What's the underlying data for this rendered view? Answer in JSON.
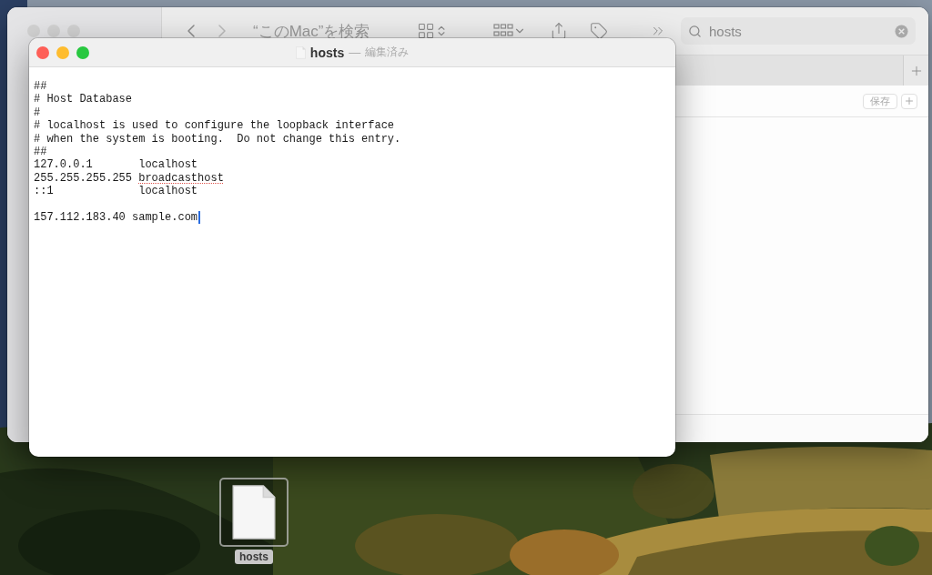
{
  "finder": {
    "title": "“このMac”を検索",
    "search": {
      "value": "hosts"
    },
    "save_button": "保存"
  },
  "editor": {
    "title": "hosts",
    "separator": "—",
    "status": "編集済み",
    "blocks": [
      {
        "lines": [
          {
            "segments": [
              {
                "text": "##",
                "misspelled": false
              }
            ],
            "caret": false
          },
          {
            "segments": [
              {
                "text": "# Host Database",
                "misspelled": false
              }
            ],
            "caret": false
          },
          {
            "segments": [
              {
                "text": "#",
                "misspelled": false
              }
            ],
            "caret": false
          },
          {
            "segments": [
              {
                "text": "# localhost is used to configure the loopback interface",
                "misspelled": false
              }
            ],
            "caret": false
          },
          {
            "segments": [
              {
                "text": "# when the system is booting.  Do not change this entry.",
                "misspelled": false
              }
            ],
            "caret": false
          },
          {
            "segments": [
              {
                "text": "##",
                "misspelled": false
              }
            ],
            "caret": false
          },
          {
            "segments": [
              {
                "text": "127.0.0.1       localhost",
                "misspelled": false
              }
            ],
            "caret": false
          },
          {
            "segments": [
              {
                "text": "255.255.255.255 ",
                "misspelled": false
              },
              {
                "text": "broadcasthost",
                "misspelled": true
              }
            ],
            "caret": false
          },
          {
            "segments": [
              {
                "text": "::1             localhost",
                "misspelled": false
              }
            ],
            "caret": false
          }
        ]
      },
      {
        "lines": [
          {
            "segments": [
              {
                "text": "157.112.183.40 sample.com",
                "misspelled": false
              }
            ],
            "caret": true
          }
        ]
      }
    ]
  },
  "desktop": {
    "file_icon": {
      "label": "hosts",
      "selected": true
    }
  }
}
